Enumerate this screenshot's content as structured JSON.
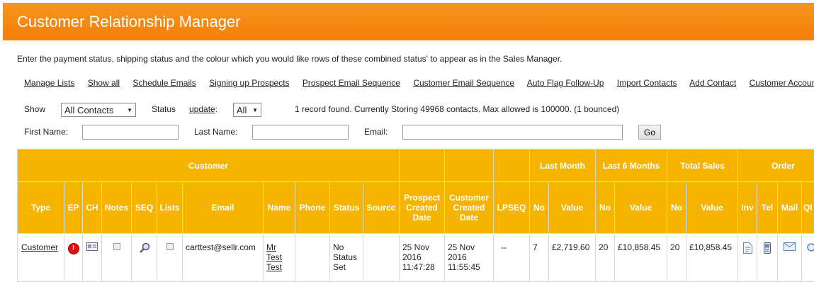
{
  "header": {
    "title": "Customer Relationship Manager"
  },
  "intro": "Enter the payment status, shipping status and the colour which you would like rows of these combined status' to appear as in the Sales Manager.",
  "nav": [
    "Manage Lists",
    "Show all",
    "Schedule Emails",
    "Signing up Prospects",
    "Prospect Email Sequence",
    "Customer Email Sequence",
    "Auto Flag Follow-Up",
    "Import Contacts",
    "Add Contact",
    "Customer Accounts"
  ],
  "filters": {
    "show_label": "Show",
    "show_value": "All Contacts",
    "status_label": "Status",
    "update_link": "update",
    ":": ":",
    "status_value": "All",
    "info": "1 record found. Currently Storing 49968 contacts. Max allowed is 100000. (1 bounced)",
    "first_name_label": "First Name:",
    "last_name_label": "Last Name:",
    "email_label": "Email:",
    "go": "Go"
  },
  "table": {
    "group_headers": {
      "customer": "Customer",
      "last_month": "Last Month",
      "last_6_months": "Last 6 Months",
      "total_sales": "Total Sales",
      "order": "Order"
    },
    "columns": [
      "Type",
      "EP",
      "CH",
      "Notes",
      "SEQ",
      "Lists",
      "Email",
      "Name",
      "Phone",
      "Status",
      "Source",
      "Prospect Created Date",
      "Customer Created Date",
      "LPSEQ",
      "No",
      "Value",
      "No",
      "Value",
      "No",
      "Value",
      "Inv",
      "Tel",
      "Mail",
      "QI"
    ],
    "row": {
      "type": "Customer",
      "email": "carttest@sellr.com",
      "name": [
        "Mr",
        "Test",
        "Test"
      ],
      "status": "No Status Set",
      "prospect_date": "25 Nov 2016 11:47:28",
      "customer_date": "25 Nov 2016 11:55:45",
      "lpseq": "--",
      "lm_no": "7",
      "lm_value": "£2,719.60",
      "l6_no": "20",
      "l6_value": "£10,858.45",
      "ts_no": "20",
      "ts_value": "£10,858.45"
    }
  }
}
